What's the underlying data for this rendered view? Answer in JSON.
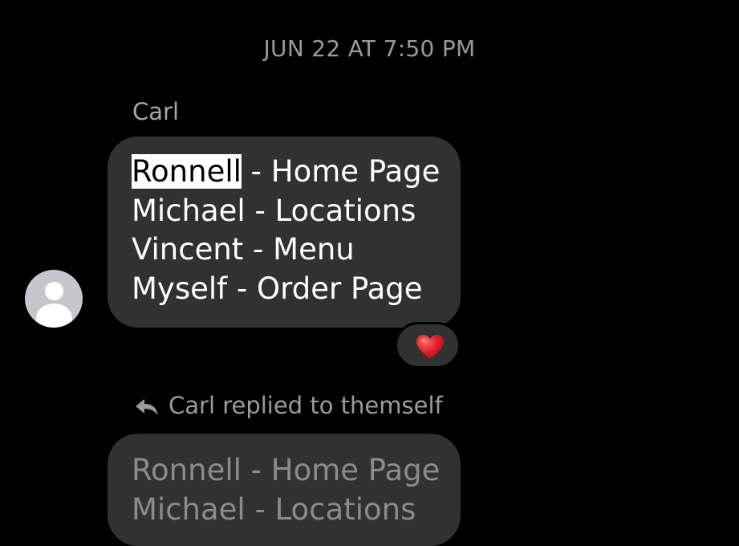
{
  "thread": {
    "timestamp": "JUN 22 AT 7:50 PM"
  },
  "message": {
    "sender": "Carl",
    "highlighted_word": "Ronnell",
    "first_line_rest": " - Home Page",
    "lines": [
      "Ronnell - Home Page",
      "Michael - Locations",
      "Vincent - Menu",
      "Myself - Order Page"
    ],
    "reaction": "heart-emoji"
  },
  "reply": {
    "note": "Carl replied to themself",
    "quoted_lines": [
      "Ronnell - Home Page",
      "Michael - Locations"
    ]
  },
  "colors": {
    "background": "#000000",
    "bubble": "#313131",
    "heart": "#e0202a"
  }
}
